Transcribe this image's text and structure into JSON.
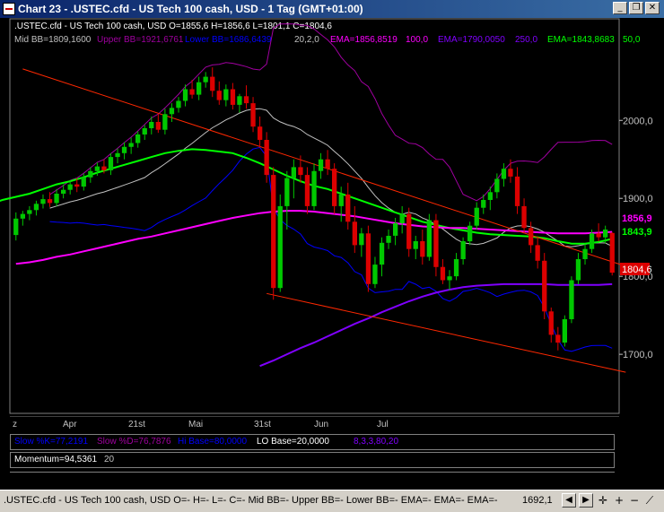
{
  "window": {
    "title": "Chart 23 - .USTEC.cfd - US Tech 100 cash, USD - 1 Tag (GMT+01:00)",
    "minimize_glyph": "_",
    "restore_glyph": "❐",
    "close_glyph": "✕"
  },
  "header": {
    "ohlc": ".USTEC.cfd - US Tech 100 cash, USD O=1855,6 H=1856,6 L=1801,1 C=1804,6",
    "ohlc_color": "#ffffff",
    "ind_mid": "Mid BB=1809,1600",
    "ind_upper": "Upper BB=1921,6761",
    "ind_lower": "Lower BB=1686,6439",
    "ind_bbparams": "20,2,0",
    "ind_ema100": "EMA=1856,8519",
    "ind_ema100_p": "100,0",
    "ind_ema250": "EMA=1790,0050",
    "ind_ema250_p": "250,0",
    "ind_ema50": "EMA=1843,8683",
    "ind_ema50_p": "50,0"
  },
  "price_axis": {
    "labels": [
      "2000,0",
      "1900,0",
      "1800,0",
      "1700,0"
    ],
    "badge_ema100": "1856,9",
    "badge_ema50": "1843,9",
    "badge_close": "1804,6"
  },
  "time_axis": {
    "labels": [
      "z",
      "Apr",
      "21st",
      "Mai",
      "31st",
      "Jun",
      "Jul"
    ]
  },
  "indicators": {
    "stoch": {
      "label_k": "Slow %K=77,2191",
      "label_d": "Slow %D=76,7876",
      "label_hi": "Hi Base=80,0000",
      "label_lo": "LO Base=20,0000",
      "params": "8,3,3,80,20"
    },
    "momentum": {
      "label": "Momentum=94,5361",
      "param": "20"
    }
  },
  "status": {
    "text": ".USTEC.cfd - US Tech 100 cash, USD O=- H=- L=- C=- Mid BB=- Upper BB=- Lower BB=- EMA=- EMA=- EMA=-",
    "price": "1692,1"
  },
  "colors": {
    "up": "#00c800",
    "down": "#dc0000",
    "channel": "#ff2800",
    "ema50": "#00ff00",
    "ema100": "#ff00ff",
    "ema250": "#8000ff",
    "bb_upper": "#a000a0",
    "bb_lower": "#0000ff",
    "bb_mid": "#c0c0c0"
  },
  "chart_data": {
    "type": "candlestick",
    "symbol": ".USTEC.cfd",
    "timeframe": "1 Tag",
    "ylim": [
      1630,
      2090
    ],
    "last": {
      "open": 1855.6,
      "high": 1856.6,
      "low": 1801.1,
      "close": 1804.6
    },
    "candles": [
      [
        1853,
        1882,
        1846,
        1874
      ],
      [
        1874,
        1884,
        1865,
        1880
      ],
      [
        1880,
        1890,
        1872,
        1885
      ],
      [
        1885,
        1897,
        1878,
        1893
      ],
      [
        1893,
        1905,
        1887,
        1899
      ],
      [
        1899,
        1908,
        1889,
        1894
      ],
      [
        1894,
        1912,
        1890,
        1906
      ],
      [
        1906,
        1918,
        1900,
        1911
      ],
      [
        1911,
        1923,
        1905,
        1918
      ],
      [
        1918,
        1926,
        1908,
        1915
      ],
      [
        1915,
        1932,
        1910,
        1927
      ],
      [
        1927,
        1940,
        1920,
        1935
      ],
      [
        1935,
        1946,
        1929,
        1941
      ],
      [
        1941,
        1950,
        1932,
        1936
      ],
      [
        1936,
        1958,
        1930,
        1953
      ],
      [
        1953,
        1964,
        1945,
        1958
      ],
      [
        1958,
        1972,
        1950,
        1966
      ],
      [
        1966,
        1978,
        1957,
        1971
      ],
      [
        1971,
        1986,
        1965,
        1982
      ],
      [
        1982,
        1994,
        1975,
        1990
      ],
      [
        1990,
        2005,
        1982,
        1998
      ],
      [
        1998,
        2008,
        1984,
        1988
      ],
      [
        1988,
        2015,
        1982,
        2008
      ],
      [
        2008,
        2022,
        1998,
        2016
      ],
      [
        2016,
        2030,
        2010,
        2025
      ],
      [
        2025,
        2046,
        2018,
        2040
      ],
      [
        2040,
        2052,
        2028,
        2033
      ],
      [
        2033,
        2056,
        2026,
        2049
      ],
      [
        2049,
        2062,
        2042,
        2056
      ],
      [
        2056,
        2068,
        2030,
        2038
      ],
      [
        2038,
        2050,
        2020,
        2026
      ],
      [
        2026,
        2046,
        2018,
        2040
      ],
      [
        2040,
        2048,
        2014,
        2020
      ],
      [
        2020,
        2034,
        2010,
        2031
      ],
      [
        2031,
        2045,
        2015,
        2022
      ],
      [
        2022,
        2030,
        1985,
        1992
      ],
      [
        1992,
        2005,
        1965,
        1975
      ],
      [
        1975,
        1985,
        1920,
        1930
      ],
      [
        1930,
        1940,
        1770,
        1785
      ],
      [
        1785,
        1905,
        1780,
        1890
      ],
      [
        1890,
        1935,
        1860,
        1926
      ],
      [
        1926,
        1950,
        1900,
        1940
      ],
      [
        1940,
        1955,
        1920,
        1930
      ],
      [
        1930,
        1940,
        1880,
        1890
      ],
      [
        1890,
        1945,
        1885,
        1935
      ],
      [
        1935,
        1958,
        1925,
        1950
      ],
      [
        1950,
        1962,
        1930,
        1938
      ],
      [
        1938,
        1945,
        1880,
        1890
      ],
      [
        1890,
        1915,
        1870,
        1905
      ],
      [
        1905,
        1920,
        1860,
        1870
      ],
      [
        1870,
        1890,
        1830,
        1840
      ],
      [
        1840,
        1862,
        1825,
        1855
      ],
      [
        1855,
        1865,
        1780,
        1790
      ],
      [
        1790,
        1825,
        1785,
        1815
      ],
      [
        1815,
        1850,
        1800,
        1843
      ],
      [
        1843,
        1860,
        1835,
        1852
      ],
      [
        1852,
        1875,
        1840,
        1868
      ],
      [
        1868,
        1890,
        1855,
        1880
      ],
      [
        1880,
        1888,
        1825,
        1835
      ],
      [
        1835,
        1852,
        1822,
        1845
      ],
      [
        1845,
        1860,
        1815,
        1825
      ],
      [
        1825,
        1880,
        1820,
        1872
      ],
      [
        1872,
        1880,
        1800,
        1812
      ],
      [
        1812,
        1822,
        1790,
        1795
      ],
      [
        1795,
        1808,
        1782,
        1800
      ],
      [
        1800,
        1830,
        1795,
        1822
      ],
      [
        1822,
        1850,
        1815,
        1845
      ],
      [
        1845,
        1870,
        1840,
        1865
      ],
      [
        1865,
        1895,
        1860,
        1888
      ],
      [
        1888,
        1905,
        1880,
        1898
      ],
      [
        1898,
        1915,
        1885,
        1908
      ],
      [
        1908,
        1932,
        1900,
        1925
      ],
      [
        1925,
        1945,
        1915,
        1938
      ],
      [
        1938,
        1950,
        1920,
        1928
      ],
      [
        1928,
        1940,
        1880,
        1890
      ],
      [
        1890,
        1900,
        1855,
        1862
      ],
      [
        1862,
        1870,
        1830,
        1840
      ],
      [
        1840,
        1850,
        1810,
        1820
      ],
      [
        1820,
        1830,
        1745,
        1755
      ],
      [
        1755,
        1760,
        1715,
        1725
      ],
      [
        1725,
        1735,
        1705,
        1715
      ],
      [
        1715,
        1750,
        1710,
        1745
      ],
      [
        1745,
        1800,
        1740,
        1795
      ],
      [
        1795,
        1830,
        1790,
        1822
      ],
      [
        1822,
        1842,
        1815,
        1835
      ],
      [
        1835,
        1860,
        1830,
        1855
      ],
      [
        1855,
        1868,
        1845,
        1850
      ],
      [
        1850,
        1865,
        1842,
        1860
      ],
      [
        1855.6,
        1856.6,
        1801.1,
        1804.6
      ]
    ],
    "series": [
      {
        "name": "EMA 50",
        "values": [
          1855,
          1860,
          1866,
          1872,
          1877,
          1882,
          1886,
          1892,
          1898,
          1902,
          1906,
          1912,
          1918,
          1922,
          1927,
          1933,
          1938,
          1943,
          1948,
          1953,
          1958,
          1961,
          1963,
          1962,
          1960,
          1958,
          1952,
          1945,
          1937,
          1929,
          1922,
          1916,
          1912,
          1906,
          1900,
          1894,
          1888,
          1882,
          1876,
          1870,
          1866,
          1862,
          1859,
          1856,
          1854,
          1853,
          1852,
          1851,
          1849,
          1845,
          1842,
          1842,
          1844,
          1848
        ]
      },
      {
        "name": "EMA 100",
        "values": [
          1816,
          1818,
          1821,
          1825,
          1828,
          1832,
          1836,
          1840,
          1844,
          1848,
          1851,
          1855,
          1859,
          1863,
          1867,
          1871,
          1875,
          1878,
          1881,
          1883,
          1884,
          1884,
          1883,
          1881,
          1879,
          1877,
          1874,
          1871,
          1868,
          1866,
          1864,
          1863,
          1862,
          1862,
          1861,
          1860,
          1859,
          1858,
          1857,
          1856,
          1855,
          1855,
          1855,
          1856,
          1857
        ]
      },
      {
        "name": "EMA 250",
        "values": [
          1685,
          1692,
          1700,
          1708,
          1715,
          1723,
          1731,
          1739,
          1746,
          1754,
          1761,
          1768,
          1774,
          1779,
          1783,
          1786,
          1788,
          1789,
          1790,
          1790,
          1790,
          1790,
          1789,
          1789,
          1789,
          1789,
          1790
        ]
      }
    ],
    "channel_upper": [
      [
        1,
        2066
      ],
      [
        90,
        1813
      ]
    ],
    "channel_lower": [
      [
        37,
        1778
      ],
      [
        90,
        1677
      ]
    ],
    "annotations": [],
    "xlabel": "",
    "ylabel": ""
  }
}
